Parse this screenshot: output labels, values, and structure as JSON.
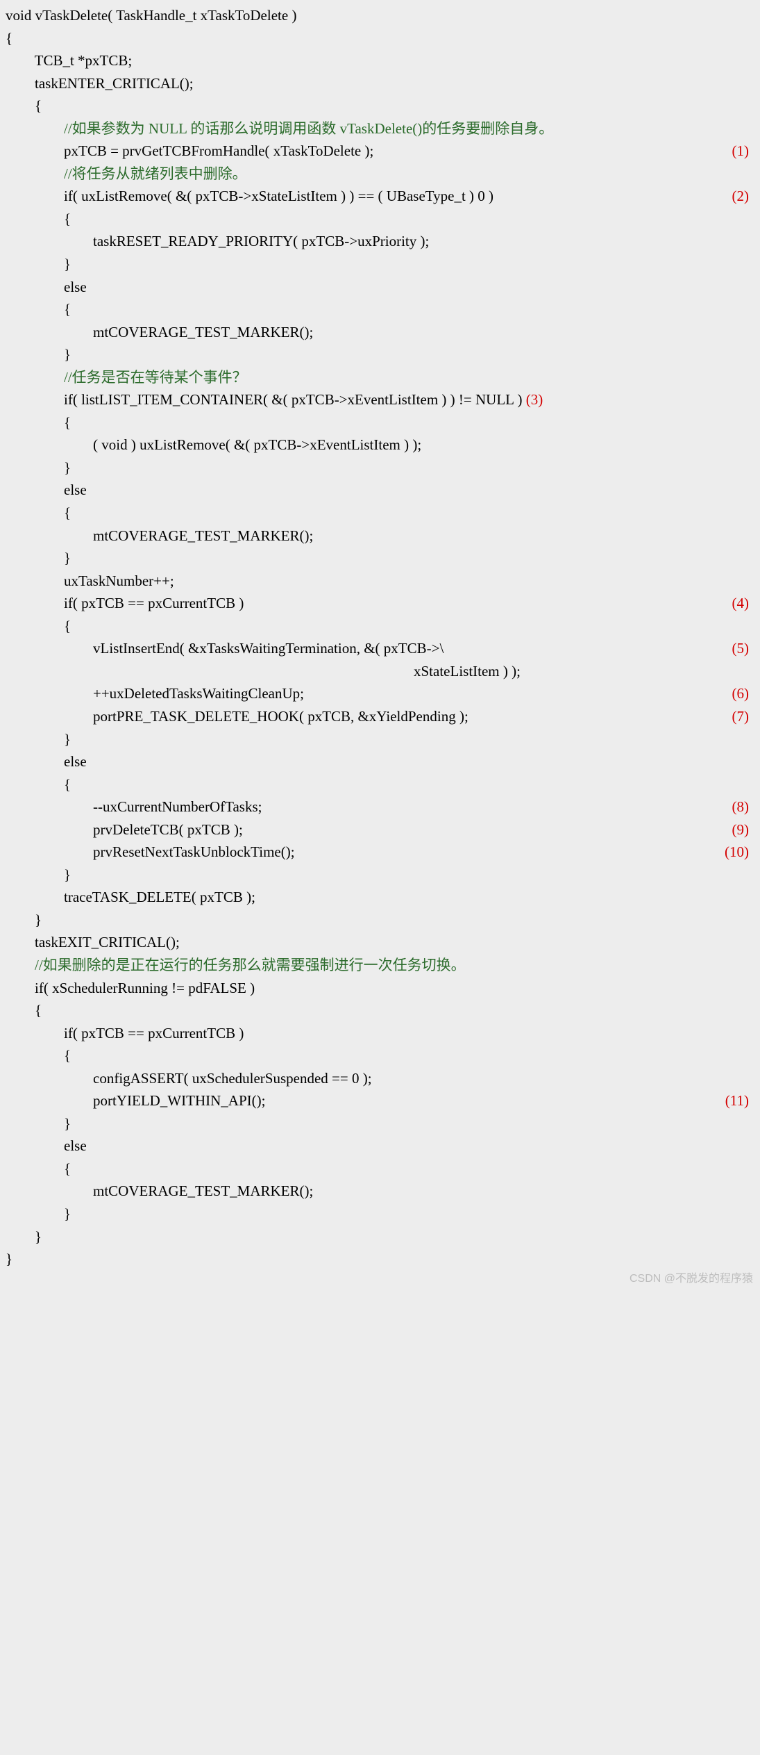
{
  "lines": {
    "l1": "void vTaskDelete( TaskHandle_t xTaskToDelete )",
    "l2": "{",
    "l3": "        TCB_t *pxTCB;",
    "l4": "",
    "l5": "        taskENTER_CRITICAL();",
    "l6": "        {",
    "l7": "                //如果参数为 NULL 的话那么说明调用函数 vTaskDelete()的任务要删除自身。",
    "l8": "                pxTCB = prvGetTCBFromHandle( xTaskToDelete );",
    "l9": "",
    "l10": "                //将任务从就绪列表中删除。",
    "l11": "                if( uxListRemove( &( pxTCB->xStateListItem ) ) == ( UBaseType_t ) 0 )",
    "l12": "                {",
    "l13": "                        taskRESET_READY_PRIORITY( pxTCB->uxPriority );",
    "l14": "                }",
    "l15": "                else",
    "l16": "                {",
    "l17": "                        mtCOVERAGE_TEST_MARKER();",
    "l18": "                }",
    "l19": "",
    "l20": "                //任务是否在等待某个事件？",
    "l21a": "                if( listLIST_ITEM_CONTAINER( &( pxTCB->xEventListItem ) ) != NULL ) ",
    "l22": "                {",
    "l23": "                        ( void ) uxListRemove( &( pxTCB->xEventListItem ) );",
    "l24": "                }",
    "l25": "                else",
    "l26": "                {",
    "l27": "                        mtCOVERAGE_TEST_MARKER();",
    "l28": "                }",
    "l29": "",
    "l30": "                uxTaskNumber++;",
    "l31": "",
    "l32": "                if( pxTCB == pxCurrentTCB )",
    "l33": "                {",
    "l34": "                        vListInsertEnd( &xTasksWaitingTermination, &( pxTCB->\\",
    "l35": "                                                                                                                xStateListItem ) );",
    "l36": "",
    "l37": "                        ++uxDeletedTasksWaitingCleanUp;",
    "l38": "",
    "l39": "                        portPRE_TASK_DELETE_HOOK( pxTCB, &xYieldPending );",
    "l40": "                }",
    "l41": "                else",
    "l42": "                {",
    "l43": "                        --uxCurrentNumberOfTasks;",
    "l44": "                        prvDeleteTCB( pxTCB );",
    "l45": "                        prvResetNextTaskUnblockTime();",
    "l46": "                }",
    "l47": "",
    "l48": "                traceTASK_DELETE( pxTCB );",
    "l49": "        }",
    "l50": "        taskEXIT_CRITICAL();",
    "l51": "",
    "l52": "        //如果删除的是正在运行的任务那么就需要强制进行一次任务切换。",
    "l53": "        if( xSchedulerRunning != pdFALSE )",
    "l54": "        {",
    "l55": "                if( pxTCB == pxCurrentTCB )",
    "l56": "                {",
    "l57": "                        configASSERT( uxSchedulerSuspended == 0 );",
    "l58": "                        portYIELD_WITHIN_API();",
    "l59": "                }",
    "l60": "                else",
    "l61": "                {",
    "l62": "                        mtCOVERAGE_TEST_MARKER();",
    "l63": "                }",
    "l64": "        }",
    "l65": "}"
  },
  "marks": {
    "m1": "(1)",
    "m2": "(2)",
    "m3": "(3)",
    "m4": "(4)",
    "m5": "(5)",
    "m6": "(6)",
    "m7": "(7)",
    "m8": "(8)",
    "m9": "(9)",
    "m10": "(10)",
    "m11": "(11)"
  },
  "watermark": "CSDN @不脱发的程序猿"
}
